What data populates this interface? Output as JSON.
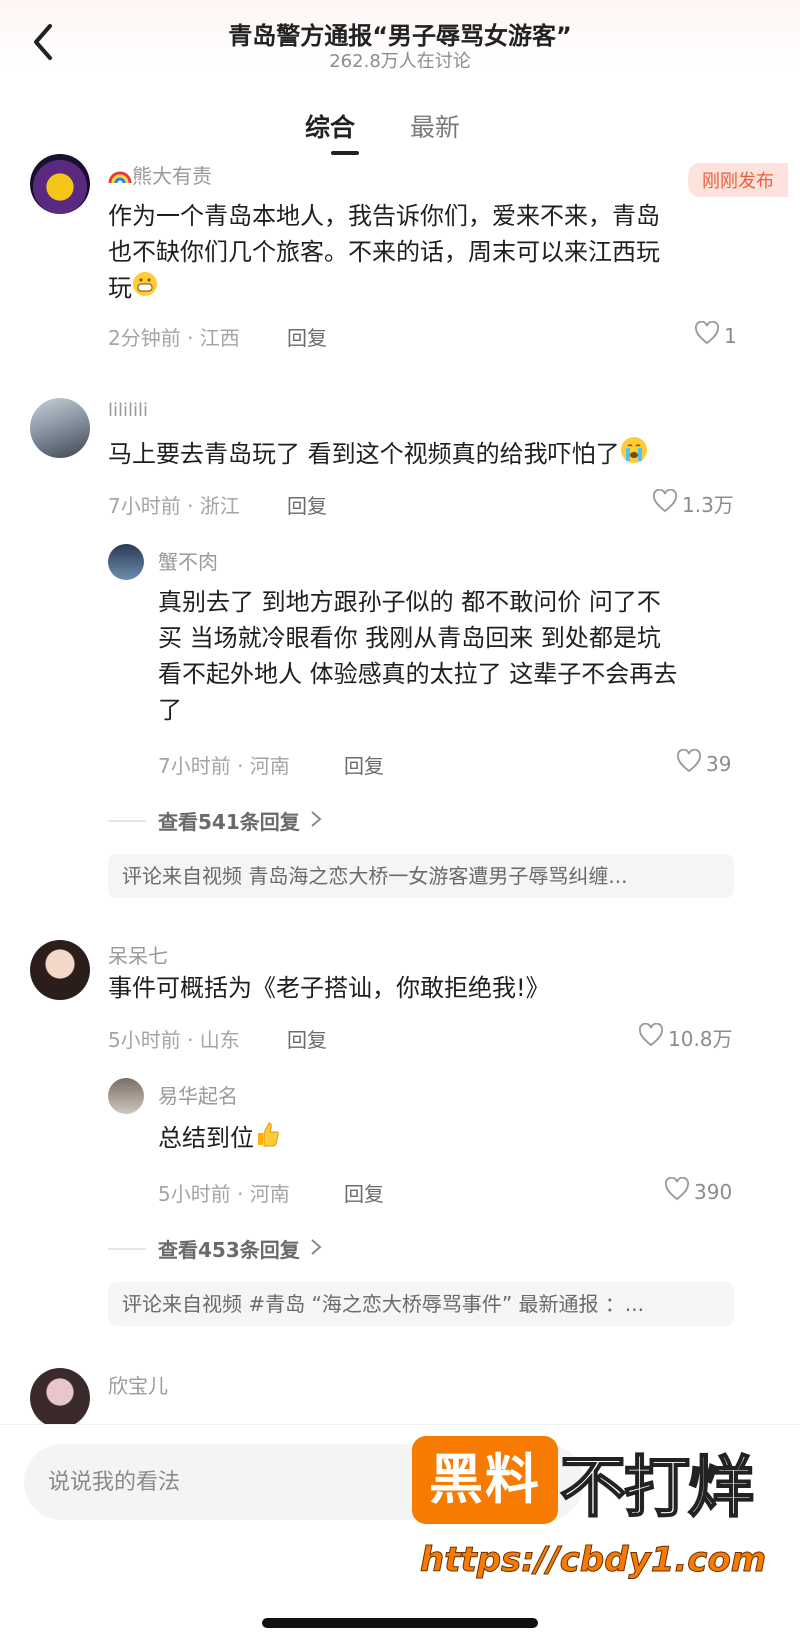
{
  "header": {
    "title": "青岛警方通报“男子辱骂女游客”",
    "subtitle": "262.8万人在讨论"
  },
  "tabs": [
    {
      "label": "综合",
      "active": true
    },
    {
      "label": "最新",
      "active": false
    }
  ],
  "badge": "刚刚发布",
  "comments": [
    {
      "username": "熊大有责",
      "text_lines": [
        "作为一个青岛本地人，我告诉你们，爱来不来，青岛",
        "也不缺你们几个旅客。不来的话，周末可以来江西玩",
        "玩"
      ],
      "meta": "2分钟前 · 江西",
      "reply_label": "回复",
      "likes": "1"
    },
    {
      "username": "lililili",
      "text_lines": [
        "马上要去青岛玩了 看到这个视频真的给我吓怕了"
      ],
      "meta": "7小时前 · 浙江",
      "reply_label": "回复",
      "likes": "1.3万",
      "reply": {
        "username": "蟹不肉",
        "text_lines": [
          "真别去了 到地方跟孙子似的 都不敢问价 问了不",
          "买 当场就冷眼看你 我刚从青岛回来 到处都是坑",
          "看不起外地人 体验感真的太拉了 这辈子不会再去",
          "了"
        ],
        "meta": "7小时前 · 河南",
        "reply_label": "回复",
        "likes": "39"
      },
      "view_replies": "查看541条回复",
      "source": "评论来自视频  青岛海之恋大桥一女游客遭男子辱骂纠缠..."
    },
    {
      "username": "呆呆七",
      "text_lines": [
        "事件可概括为《老子搭讪，你敢拒绝我!》"
      ],
      "meta": "5小时前 · 山东",
      "reply_label": "回复",
      "likes": "10.8万",
      "reply": {
        "username": "易华起名",
        "text_lines": [
          "总结到位"
        ],
        "meta": "5小时前 · 河南",
        "reply_label": "回复",
        "likes": "390"
      },
      "view_replies": "查看453条回复",
      "source": "评论来自视频  #青岛 “海之恋大桥辱骂事件” 最新通报 ：..."
    },
    {
      "username": "欣宝儿"
    }
  ],
  "input": {
    "placeholder": "说说我的看法"
  },
  "watermark": {
    "box_text": "黑料",
    "text": "不打烊",
    "url": "https://cbdy1.com"
  },
  "colors": {
    "accent": "#f25c3d",
    "watermark": "#f77b00"
  }
}
